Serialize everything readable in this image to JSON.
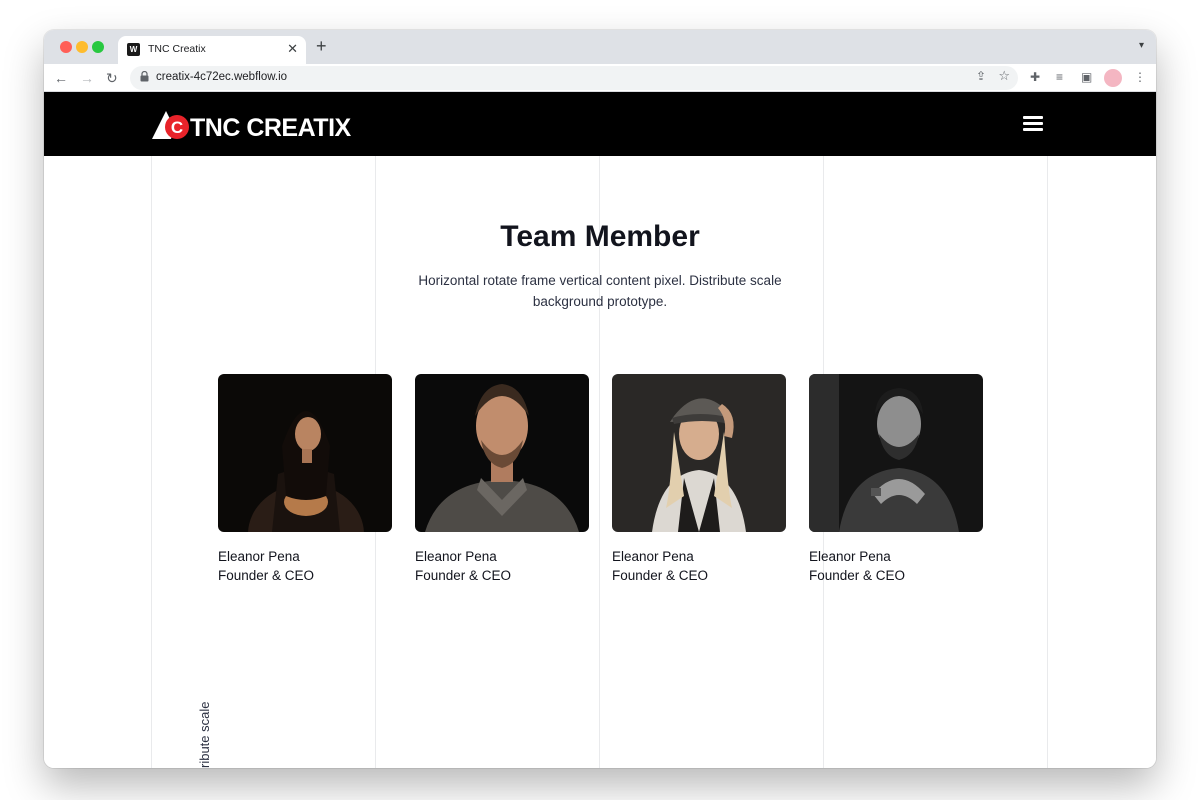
{
  "browser": {
    "tab_title": "TNC Creatix",
    "tab_favicon_text": "W",
    "url": "creatix-4c72ec.webflow.io"
  },
  "site": {
    "logo_text": "TNC CREATIX",
    "logo_badge_letter": "C",
    "brand_red": "#e8232a"
  },
  "section": {
    "title": "Team Member",
    "description": "Horizontal rotate frame vertical content pixel. Distribute scale background prototype.",
    "vertical_snippet": "ribute scale"
  },
  "members": [
    {
      "name": "Eleanor Pena",
      "role": "Founder & CEO"
    },
    {
      "name": "Eleanor Pena",
      "role": "Founder & CEO"
    },
    {
      "name": "Eleanor Pena",
      "role": "Founder & CEO"
    },
    {
      "name": "Eleanor Pena",
      "role": "Founder & CEO"
    }
  ]
}
